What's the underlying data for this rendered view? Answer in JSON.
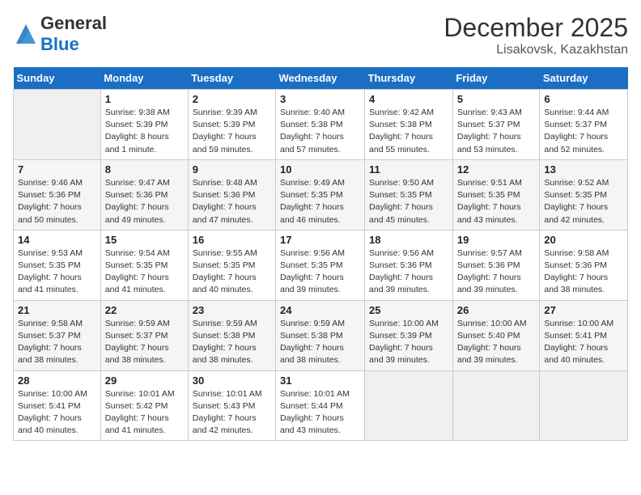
{
  "header": {
    "logo_general": "General",
    "logo_blue": "Blue",
    "title": "December 2025",
    "subtitle": "Lisakovsk, Kazakhstan"
  },
  "days_of_week": [
    "Sunday",
    "Monday",
    "Tuesday",
    "Wednesday",
    "Thursday",
    "Friday",
    "Saturday"
  ],
  "weeks": [
    [
      {
        "day": "",
        "empty": true
      },
      {
        "day": "1",
        "sunrise": "Sunrise: 9:38 AM",
        "sunset": "Sunset: 5:39 PM",
        "daylight": "Daylight: 8 hours and 1 minute."
      },
      {
        "day": "2",
        "sunrise": "Sunrise: 9:39 AM",
        "sunset": "Sunset: 5:39 PM",
        "daylight": "Daylight: 7 hours and 59 minutes."
      },
      {
        "day": "3",
        "sunrise": "Sunrise: 9:40 AM",
        "sunset": "Sunset: 5:38 PM",
        "daylight": "Daylight: 7 hours and 57 minutes."
      },
      {
        "day": "4",
        "sunrise": "Sunrise: 9:42 AM",
        "sunset": "Sunset: 5:38 PM",
        "daylight": "Daylight: 7 hours and 55 minutes."
      },
      {
        "day": "5",
        "sunrise": "Sunrise: 9:43 AM",
        "sunset": "Sunset: 5:37 PM",
        "daylight": "Daylight: 7 hours and 53 minutes."
      },
      {
        "day": "6",
        "sunrise": "Sunrise: 9:44 AM",
        "sunset": "Sunset: 5:37 PM",
        "daylight": "Daylight: 7 hours and 52 minutes."
      }
    ],
    [
      {
        "day": "7",
        "sunrise": "Sunrise: 9:46 AM",
        "sunset": "Sunset: 5:36 PM",
        "daylight": "Daylight: 7 hours and 50 minutes."
      },
      {
        "day": "8",
        "sunrise": "Sunrise: 9:47 AM",
        "sunset": "Sunset: 5:36 PM",
        "daylight": "Daylight: 7 hours and 49 minutes."
      },
      {
        "day": "9",
        "sunrise": "Sunrise: 9:48 AM",
        "sunset": "Sunset: 5:36 PM",
        "daylight": "Daylight: 7 hours and 47 minutes."
      },
      {
        "day": "10",
        "sunrise": "Sunrise: 9:49 AM",
        "sunset": "Sunset: 5:35 PM",
        "daylight": "Daylight: 7 hours and 46 minutes."
      },
      {
        "day": "11",
        "sunrise": "Sunrise: 9:50 AM",
        "sunset": "Sunset: 5:35 PM",
        "daylight": "Daylight: 7 hours and 45 minutes."
      },
      {
        "day": "12",
        "sunrise": "Sunrise: 9:51 AM",
        "sunset": "Sunset: 5:35 PM",
        "daylight": "Daylight: 7 hours and 43 minutes."
      },
      {
        "day": "13",
        "sunrise": "Sunrise: 9:52 AM",
        "sunset": "Sunset: 5:35 PM",
        "daylight": "Daylight: 7 hours and 42 minutes."
      }
    ],
    [
      {
        "day": "14",
        "sunrise": "Sunrise: 9:53 AM",
        "sunset": "Sunset: 5:35 PM",
        "daylight": "Daylight: 7 hours and 41 minutes."
      },
      {
        "day": "15",
        "sunrise": "Sunrise: 9:54 AM",
        "sunset": "Sunset: 5:35 PM",
        "daylight": "Daylight: 7 hours and 41 minutes."
      },
      {
        "day": "16",
        "sunrise": "Sunrise: 9:55 AM",
        "sunset": "Sunset: 5:35 PM",
        "daylight": "Daylight: 7 hours and 40 minutes."
      },
      {
        "day": "17",
        "sunrise": "Sunrise: 9:56 AM",
        "sunset": "Sunset: 5:35 PM",
        "daylight": "Daylight: 7 hours and 39 minutes."
      },
      {
        "day": "18",
        "sunrise": "Sunrise: 9:56 AM",
        "sunset": "Sunset: 5:36 PM",
        "daylight": "Daylight: 7 hours and 39 minutes."
      },
      {
        "day": "19",
        "sunrise": "Sunrise: 9:57 AM",
        "sunset": "Sunset: 5:36 PM",
        "daylight": "Daylight: 7 hours and 39 minutes."
      },
      {
        "day": "20",
        "sunrise": "Sunrise: 9:58 AM",
        "sunset": "Sunset: 5:36 PM",
        "daylight": "Daylight: 7 hours and 38 minutes."
      }
    ],
    [
      {
        "day": "21",
        "sunrise": "Sunrise: 9:58 AM",
        "sunset": "Sunset: 5:37 PM",
        "daylight": "Daylight: 7 hours and 38 minutes."
      },
      {
        "day": "22",
        "sunrise": "Sunrise: 9:59 AM",
        "sunset": "Sunset: 5:37 PM",
        "daylight": "Daylight: 7 hours and 38 minutes."
      },
      {
        "day": "23",
        "sunrise": "Sunrise: 9:59 AM",
        "sunset": "Sunset: 5:38 PM",
        "daylight": "Daylight: 7 hours and 38 minutes."
      },
      {
        "day": "24",
        "sunrise": "Sunrise: 9:59 AM",
        "sunset": "Sunset: 5:38 PM",
        "daylight": "Daylight: 7 hours and 38 minutes."
      },
      {
        "day": "25",
        "sunrise": "Sunrise: 10:00 AM",
        "sunset": "Sunset: 5:39 PM",
        "daylight": "Daylight: 7 hours and 39 minutes."
      },
      {
        "day": "26",
        "sunrise": "Sunrise: 10:00 AM",
        "sunset": "Sunset: 5:40 PM",
        "daylight": "Daylight: 7 hours and 39 minutes."
      },
      {
        "day": "27",
        "sunrise": "Sunrise: 10:00 AM",
        "sunset": "Sunset: 5:41 PM",
        "daylight": "Daylight: 7 hours and 40 minutes."
      }
    ],
    [
      {
        "day": "28",
        "sunrise": "Sunrise: 10:00 AM",
        "sunset": "Sunset: 5:41 PM",
        "daylight": "Daylight: 7 hours and 40 minutes."
      },
      {
        "day": "29",
        "sunrise": "Sunrise: 10:01 AM",
        "sunset": "Sunset: 5:42 PM",
        "daylight": "Daylight: 7 hours and 41 minutes."
      },
      {
        "day": "30",
        "sunrise": "Sunrise: 10:01 AM",
        "sunset": "Sunset: 5:43 PM",
        "daylight": "Daylight: 7 hours and 42 minutes."
      },
      {
        "day": "31",
        "sunrise": "Sunrise: 10:01 AM",
        "sunset": "Sunset: 5:44 PM",
        "daylight": "Daylight: 7 hours and 43 minutes."
      },
      {
        "day": "",
        "empty": true
      },
      {
        "day": "",
        "empty": true
      },
      {
        "day": "",
        "empty": true
      }
    ]
  ]
}
